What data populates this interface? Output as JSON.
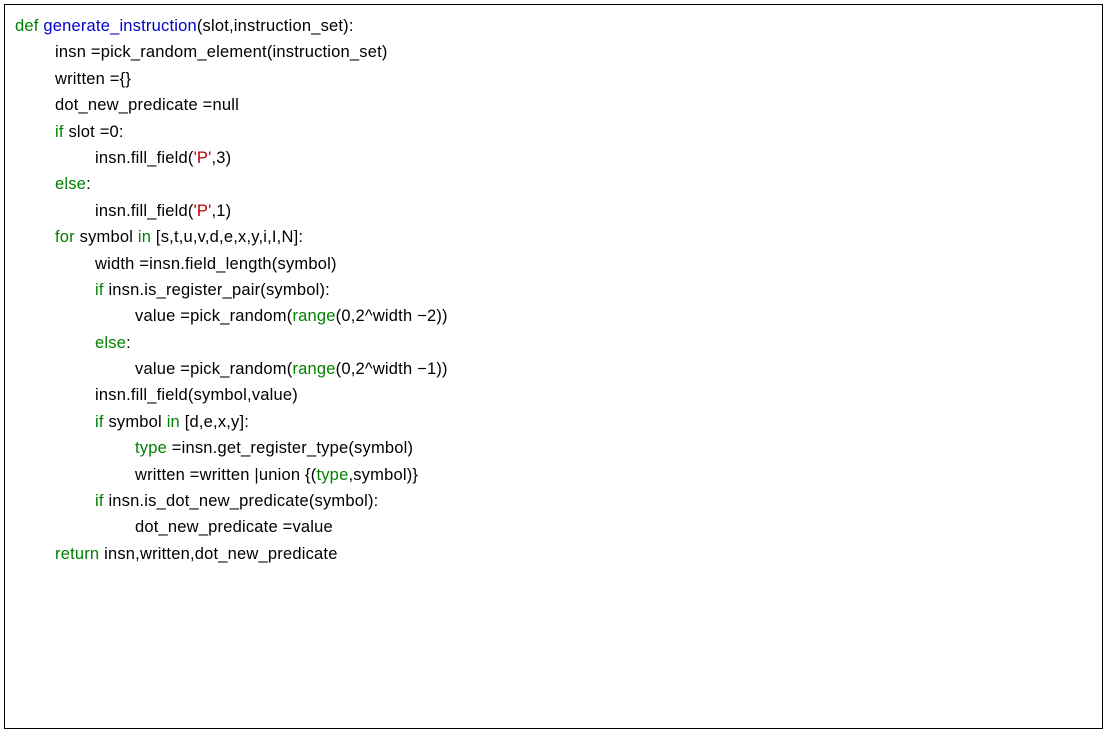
{
  "lines": [
    {
      "indent": 0,
      "parts": [
        {
          "c": "kw",
          "t": "def "
        },
        {
          "c": "fn",
          "t": "generate_instruction"
        },
        {
          "c": "txt",
          "t": "(slot,instruction_set):"
        }
      ]
    },
    {
      "indent": 1,
      "parts": [
        {
          "c": "txt",
          "t": "insn =pick_random_element(instruction_set)"
        }
      ]
    },
    {
      "indent": 1,
      "parts": [
        {
          "c": "txt",
          "t": "written ={}"
        }
      ]
    },
    {
      "indent": 1,
      "parts": [
        {
          "c": "txt",
          "t": "dot_new_predicate =null"
        }
      ]
    },
    {
      "indent": 0,
      "parts": [
        {
          "c": "txt",
          "t": ""
        }
      ]
    },
    {
      "indent": 1,
      "parts": [
        {
          "c": "kw",
          "t": "if "
        },
        {
          "c": "txt",
          "t": "slot =0:"
        }
      ]
    },
    {
      "indent": 2,
      "parts": [
        {
          "c": "txt",
          "t": "insn.fill_field("
        },
        {
          "c": "str",
          "t": "'P'"
        },
        {
          "c": "txt",
          "t": ",3)"
        }
      ]
    },
    {
      "indent": 1,
      "parts": [
        {
          "c": "kw",
          "t": "else"
        },
        {
          "c": "txt",
          "t": ":"
        }
      ]
    },
    {
      "indent": 2,
      "parts": [
        {
          "c": "txt",
          "t": "insn.fill_field("
        },
        {
          "c": "str",
          "t": "'P'"
        },
        {
          "c": "txt",
          "t": ",1)"
        }
      ]
    },
    {
      "indent": 0,
      "parts": [
        {
          "c": "txt",
          "t": ""
        }
      ]
    },
    {
      "indent": 1,
      "parts": [
        {
          "c": "kw",
          "t": "for "
        },
        {
          "c": "txt",
          "t": "symbol "
        },
        {
          "c": "kw",
          "t": "in "
        },
        {
          "c": "txt",
          "t": "[s,t,u,v,d,e,x,y,i,I,N]:"
        }
      ]
    },
    {
      "indent": 2,
      "parts": [
        {
          "c": "txt",
          "t": "width =insn.field_length(symbol)"
        }
      ]
    },
    {
      "indent": 2,
      "parts": [
        {
          "c": "kw",
          "t": "if "
        },
        {
          "c": "txt",
          "t": "insn.is_register_pair(symbol):"
        }
      ]
    },
    {
      "indent": 3,
      "parts": [
        {
          "c": "txt",
          "t": "value =pick_random("
        },
        {
          "c": "bi",
          "t": "range"
        },
        {
          "c": "txt",
          "t": "(0,2^width −2))"
        }
      ]
    },
    {
      "indent": 2,
      "parts": [
        {
          "c": "kw",
          "t": "else"
        },
        {
          "c": "txt",
          "t": ":"
        }
      ]
    },
    {
      "indent": 3,
      "parts": [
        {
          "c": "txt",
          "t": "value =pick_random("
        },
        {
          "c": "bi",
          "t": "range"
        },
        {
          "c": "txt",
          "t": "(0,2^width −1))"
        }
      ]
    },
    {
      "indent": 0,
      "parts": [
        {
          "c": "txt",
          "t": ""
        }
      ]
    },
    {
      "indent": 2,
      "parts": [
        {
          "c": "txt",
          "t": "insn.fill_field(symbol,value)"
        }
      ]
    },
    {
      "indent": 0,
      "parts": [
        {
          "c": "txt",
          "t": ""
        }
      ]
    },
    {
      "indent": 2,
      "parts": [
        {
          "c": "kw",
          "t": "if "
        },
        {
          "c": "txt",
          "t": "symbol "
        },
        {
          "c": "kw",
          "t": "in "
        },
        {
          "c": "txt",
          "t": "[d,e,x,y]:"
        }
      ]
    },
    {
      "indent": 3,
      "parts": [
        {
          "c": "bi",
          "t": "type "
        },
        {
          "c": "txt",
          "t": "=insn.get_register_type(symbol)"
        }
      ]
    },
    {
      "indent": 3,
      "parts": [
        {
          "c": "txt",
          "t": "written =written |union {("
        },
        {
          "c": "bi",
          "t": "type"
        },
        {
          "c": "txt",
          "t": ",symbol)}"
        }
      ]
    },
    {
      "indent": 2,
      "parts": [
        {
          "c": "kw",
          "t": "if "
        },
        {
          "c": "txt",
          "t": "insn.is_dot_new_predicate(symbol):"
        }
      ]
    },
    {
      "indent": 3,
      "parts": [
        {
          "c": "txt",
          "t": "dot_new_predicate =value"
        }
      ]
    },
    {
      "indent": 0,
      "parts": [
        {
          "c": "txt",
          "t": ""
        }
      ]
    },
    {
      "indent": 1,
      "parts": [
        {
          "c": "kw",
          "t": "return "
        },
        {
          "c": "txt",
          "t": "insn,written,dot_new_predicate"
        }
      ]
    }
  ]
}
